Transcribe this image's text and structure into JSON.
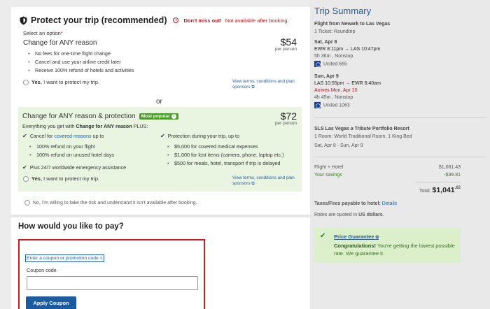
{
  "protect": {
    "title": "Protect your trip (recommended)",
    "miss_bold": "Don't miss out!",
    "miss_text": "Not available after booking.",
    "select_label": "Select an option",
    "required_mark": "*"
  },
  "option1": {
    "title": "Change for ANY reason",
    "price": "$54",
    "per": "per person",
    "bullets": [
      "No fees for one-time flight change",
      "Cancel and use your airline credit later",
      "Receive 100% refund of hotels and activities"
    ],
    "yes_bold": "Yes",
    "yes_rest": ", I want to protect my trip.",
    "terms": "View terms, conditions and plan sponsors"
  },
  "or_text": "or",
  "option2": {
    "title": "Change for ANY reason & protection",
    "popular": "Most popular",
    "price": "$72",
    "per": "per person",
    "everything_pre": "Everything you get with ",
    "everything_bold": "Change for ANY reason",
    "everything_post": " PLUS:",
    "left_check1_pre": "Cancel for ",
    "left_check1_link": "covered reasons",
    "left_check1_post": " up to",
    "left_bullets": [
      "100% refund on your flight",
      "100% refund on unused hotel days"
    ],
    "left_check2": "Plus 24/7 worldwide emergency assistance",
    "right_check": "Protection during your trip, up to",
    "right_bullets": [
      "$5,000 for covered medical expenses",
      "$1,000 for lost items (camera, phone, laptop etc.)",
      "$500 for meals, hotel, transport if trip is delayed"
    ],
    "yes_bold": "Yes",
    "yes_rest": ", I want to protect my trip.",
    "terms": "View terms, conditions and plan sponsors"
  },
  "decline": "No, I'm willing to take the risk and understand it isn't available after booking.",
  "payment": {
    "title": "How would you like to pay?",
    "coupon_link": "Enter a coupon or promotion code",
    "coupon_label": "Coupon code",
    "coupon_value": "",
    "apply": "Apply Coupon"
  },
  "sidebar": {
    "title": "Trip Summary",
    "flight_title": "Flight from Newark to Las Vegas",
    "ticket": "1 Ticket: Roundtrip",
    "out_date": "Sat, Apr 8",
    "out_route": "EWR 8:11pm → LAS 10:47pm",
    "out_duration": "5h 36m , Nonstop",
    "out_airline": "United 665",
    "ret_date": "Sun, Apr 9",
    "ret_route": "LAS 10:55pm → EWR 6:40am",
    "ret_arrives": "Arrives Mon, Apr 10",
    "ret_duration": "4h 45m , Nonstop",
    "ret_airline": "United 1063",
    "hotel_name": "SLS Las Vegas a Tribute Portfolio Resort",
    "hotel_room": "1 Room: World Traditional Room, 1 King Bed",
    "hotel_dates": "Sat, Apr 8 - Sun, Apr 9",
    "fh_label": "Flight + Hotel",
    "fh_value": "$1,081.43",
    "savings_label": "Your savings",
    "savings_value": "-$39.81",
    "total_label": "Total:",
    "total_value": "$1,041",
    "total_cents": ".62",
    "taxes_label": "Taxes/Fees payable to hotel:",
    "taxes_link": "Details",
    "rates_pre": "Rates are quoted in",
    "rates_currency": "US dollars",
    "rates_post": ".",
    "guarantee_link": "Price Guarantee",
    "guarantee_bold": "Congratulations!",
    "guarantee_text": " You're getting the lowest possible rate. We guarantee it."
  },
  "colors": {
    "accent_blue": "#1c5b9f",
    "alert_red": "#c4161c",
    "popular_green": "#4f9a2c",
    "option_bg": "#eaf5e1"
  }
}
